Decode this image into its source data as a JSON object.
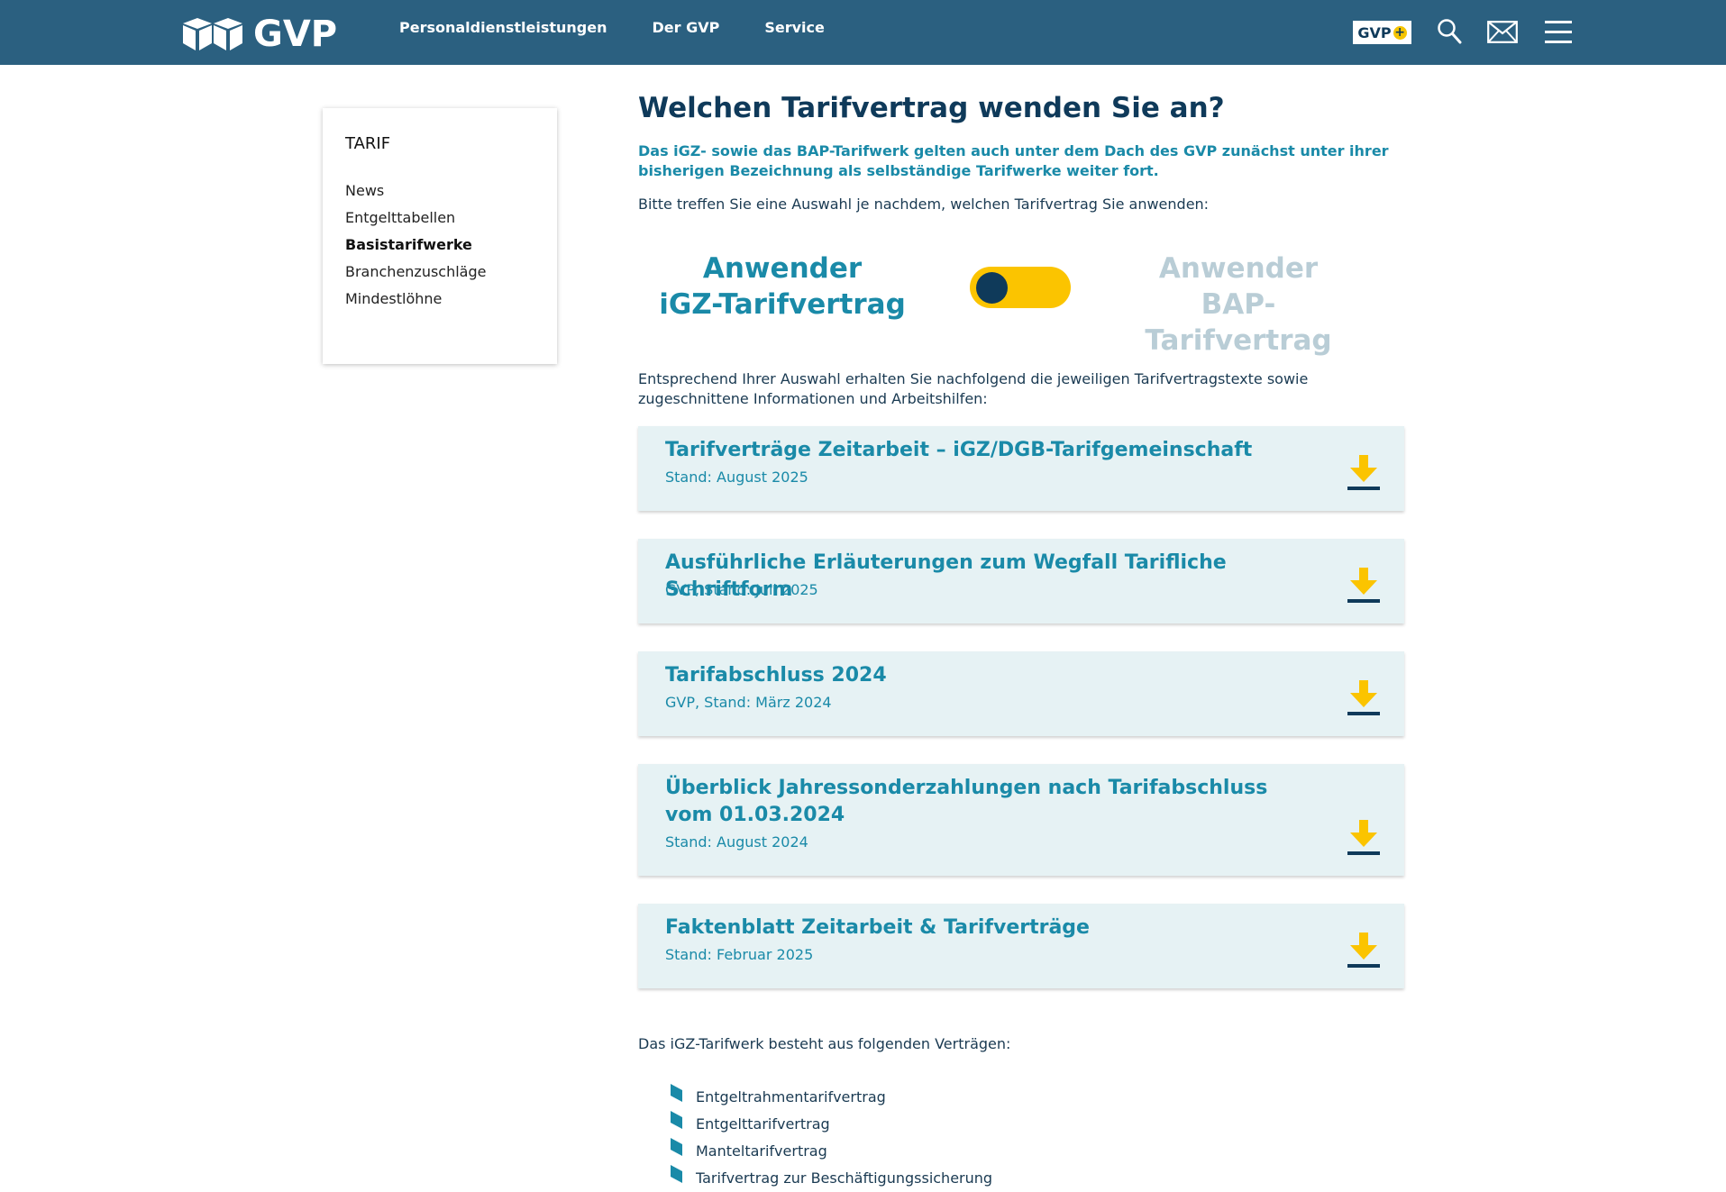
{
  "header": {
    "logo_text": "GVP",
    "nav": [
      "Personaldienstleistungen",
      "Der GVP",
      "Service"
    ],
    "gvp_plus_label": "GVP",
    "gvp_plus_symbol": "+",
    "icons": [
      "search-icon",
      "mail-icon",
      "menu-icon"
    ]
  },
  "sidebar": {
    "title": "TARIF",
    "items": [
      {
        "label": "News",
        "active": false
      },
      {
        "label": "Entgelttabellen",
        "active": false
      },
      {
        "label": "Basistarifwerke",
        "active": true
      },
      {
        "label": "Branchenzuschläge",
        "active": false
      },
      {
        "label": "Mindestlöhne",
        "active": false
      }
    ]
  },
  "main": {
    "title": "Welchen Tarifvertrag wenden Sie an?",
    "intro": "Das iGZ- sowie das BAP-Tarifwerk gelten auch unter dem Dach des GVP zunächst unter ihrer bisherigen Bezeichnung als selbständige Tarifwerke weiter fort.",
    "choose_text": "Bitte treffen Sie eine Auswahl je nachdem, welchen Tarifvertrag Sie anwenden:",
    "toggle": {
      "left_line1": "Anwender",
      "left_line2": "iGZ-Tarifvertrag",
      "right_line1": "Anwender",
      "right_line2": "BAP-Tarifvertrag",
      "selected": "left"
    },
    "after_text": "Entsprechend Ihrer Auswahl erhalten Sie nachfolgend die jeweiligen Tarifvertragstexte sowie zugeschnittene Informationen und Arbeitshilfen:",
    "downloads": [
      {
        "title": "Tarifverträge Zeitarbeit – iGZ/DGB-Tarifgemeinschaft",
        "sub": "Stand: August 2025"
      },
      {
        "title": "Ausführliche Erläuterungen zum Wegfall Tarifliche Schriftform",
        "sub": "GVP, Stand: Juli 2025"
      },
      {
        "title": "Tarifabschluss 2024",
        "sub": "GVP, Stand: März 2024"
      },
      {
        "title": "Überblick Jahressonderzahlungen nach Tarifabschluss vom 01.03.2024",
        "sub": "Stand: August 2024"
      },
      {
        "title": "Faktenblatt Zeitarbeit & Tarifverträge",
        "sub": "Stand: Februar 2025"
      }
    ],
    "list_intro": "Das iGZ-Tarifwerk besteht aus folgenden Verträgen:",
    "contracts": [
      "Entgeltrahmentarifvertrag",
      "Entgelttarifvertrag",
      "Manteltarifvertrag",
      "Tarifvertrag zur Beschäftigungssicherung"
    ]
  },
  "colors": {
    "header_bg": "#2b6080",
    "accent": "#1a8aa8",
    "dark": "#0f3a5a",
    "yellow": "#fbc400",
    "card_bg": "#e6f2f4",
    "inactive": "#b9cdd6"
  }
}
